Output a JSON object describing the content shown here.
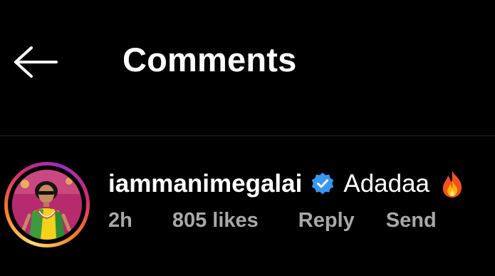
{
  "header": {
    "back_icon": "arrow-left-icon",
    "title": "Comments"
  },
  "comment": {
    "username": "iammanimegalai",
    "verified_icon": "verified-badge-icon",
    "text": "Adadaa",
    "emoji_icon": "fire-emoji-icon",
    "time": "2h",
    "likes": "805 likes",
    "reply_label": "Reply",
    "send_label": "Send"
  },
  "colors": {
    "background": "#000000",
    "text_primary": "#ffffff",
    "text_secondary": "#a8a8a8",
    "verified_blue": "#3897f0",
    "divider": "#262626"
  }
}
